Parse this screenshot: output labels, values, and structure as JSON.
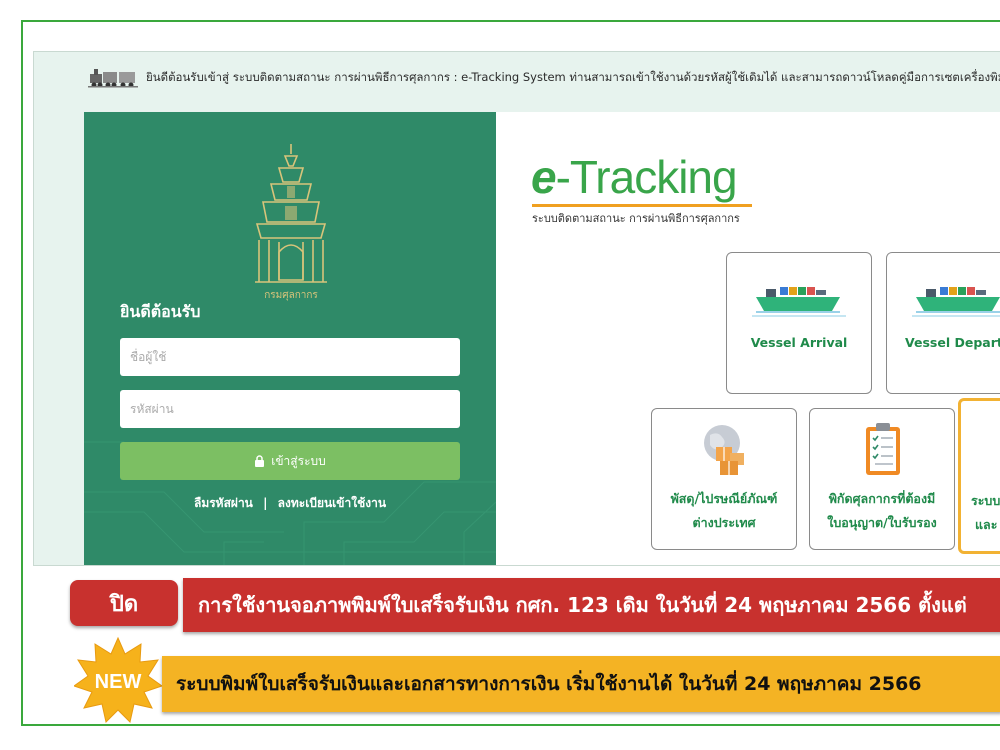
{
  "marquee": {
    "icon": "train-icon",
    "text": "ยินดีต้อนรับเข้าสู่ ระบบติดตามสถานะ การผ่านพิธีการศุลกากร : e-Tracking System ท่านสามารถเข้าใช้งานด้วยรหัสผู้ใช้เดิมได้ และสามารถดาวน์โหลดคู่มือการเซตเครื่องพิมพ์"
  },
  "login": {
    "emblem_text": "กรมศุลกากร",
    "welcome": "ยินดีต้อนรับ",
    "username_placeholder": "ชื่อผู้ใช้",
    "password_placeholder": "รหัสผ่าน",
    "login_button": "เข้าสู่ระบบ",
    "forgot_password": "ลืมรหัสผ่าน",
    "separator": "|",
    "register": "ลงทะเบียนเข้าใช้งาน"
  },
  "brand": {
    "logo_e": "e",
    "logo_rest": "-Tracking",
    "subtitle": "ระบบติดตามสถานะ การผ่านพิธีการศุลกากร"
  },
  "cards": [
    {
      "label": "Vessel Arrival",
      "icon": "cargo-ship-icon"
    },
    {
      "label": "Vessel Departu",
      "icon": "cargo-ship-icon"
    },
    {
      "label_1": "พัสดุ/ไปรษณีย์ภัณฑ์",
      "label_2": "ต่างประเทศ",
      "icon": "parcel-globe-icon"
    },
    {
      "label_1": "พิกัดศุลกากรที่ต้องมี",
      "label_2": "ใบอนุญาต/ใบรับรอง",
      "icon": "clipboard-checklist-icon"
    },
    {
      "label_1": "ระบบ",
      "label_2": "และ",
      "icon": "unknown-icon"
    }
  ],
  "notices": {
    "close_badge": "ปิด",
    "close_text": "การใช้งานจอภาพพิมพ์ใบเสร็จรับเงิน กศก. 123 เดิม ในวันที่ 24 พฤษภาคม 2566 ตั้งแต่",
    "new_badge": "NEW",
    "new_text": "ระบบพิมพ์ใบเสร็จรับเงินและเอกสารทางการเงิน เริ่มใช้งานได้ ในวันที่ 24 พฤษภาคม 2566"
  },
  "colors": {
    "frame": "#3aa83c",
    "login_panel": "#2f8a68",
    "login_button": "#7cbf63",
    "brand_green": "#39a54a",
    "close_red": "#c8312e",
    "new_yellow": "#f4b324",
    "selected_card_border": "#f2b233"
  }
}
